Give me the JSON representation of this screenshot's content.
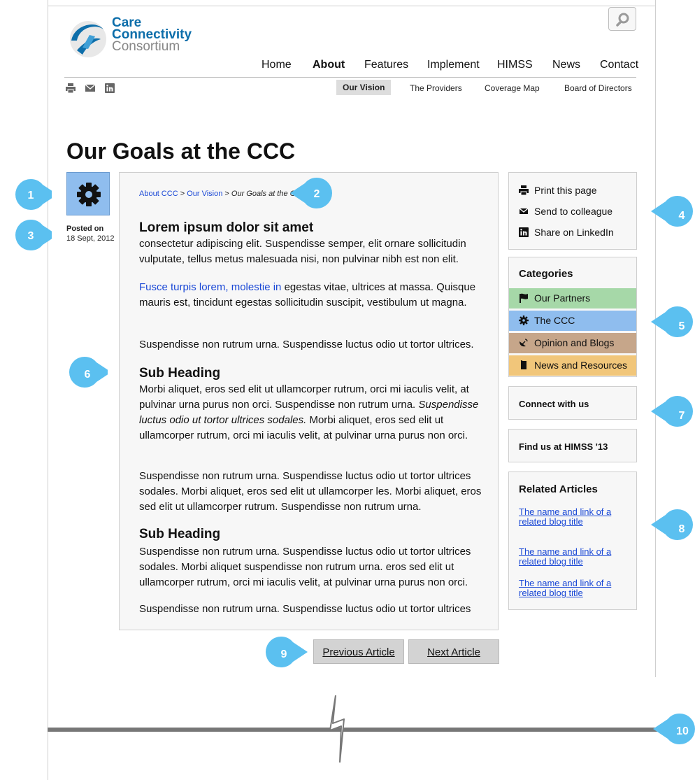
{
  "logo": {
    "line1": "Care",
    "line2": "Connectivity",
    "line3": "Consortium"
  },
  "main_nav": [
    {
      "label": "Home"
    },
    {
      "label": "About"
    },
    {
      "label": "Features"
    },
    {
      "label": "Implement"
    },
    {
      "label": "HIMSS"
    },
    {
      "label": "News"
    },
    {
      "label": "Contact"
    }
  ],
  "sub_nav": [
    {
      "label": "Our Vision"
    },
    {
      "label": "The Providers"
    },
    {
      "label": "Coverage Map"
    },
    {
      "label": "Board of Directors"
    }
  ],
  "page_title": "Our Goals at the CCC",
  "posted": {
    "label": "Posted on",
    "date": "18 Sept, 2012"
  },
  "breadcrumb": {
    "link1": "About CCC",
    "sep": " > ",
    "link2": "Our Vision",
    "current": "Our Goals at the C"
  },
  "article": {
    "heading": "Lorem ipsum dolor sit amet",
    "p1": "consectetur adipiscing elit. Suspendisse semper, elit ornare sollicitudin vulputate, tellus metus malesuada nisi, non pulvinar nibh est non elit.",
    "p2_link": "Fusce turpis lorem, molestie in",
    "p2_rest": " egestas vitae, ultrices at massa. Quisque mauris est, tincidunt egestas sollicitudin suscipit, vestibulum ut magna.",
    "p3": "Suspendisse non rutrum urna. Suspendisse luctus odio ut tortor ultrices.",
    "sub1": "Sub Heading",
    "p4_a": "Morbi aliquet, eros sed elit ut ullamcorper rutrum, orci mi iaculis velit, at pulvinar urna purus non orci. Suspendisse non rutrum urna.",
    "p4_italic": "Suspendisse luctus odio ut tortor ultrices sodales.",
    "p4_b": " Morbi aliquet, eros sed elit ut ullamcorper rutrum, orci mi iaculis velit, at pulvinar urna purus non orci.",
    "p5": "Suspendisse non rutrum urna. Suspendisse luctus odio ut tortor ultrices sodales. Morbi aliquet, eros sed elit ut ullamcorper les. Morbi aliquet, eros sed elit ut ullamcorper rutrum. Suspendisse non rutrum urna.",
    "sub2": "Sub Heading",
    "p6": "Suspendisse non rutrum urna. Suspendisse luctus odio ut tortor ultrices sodales. Morbi aliquet suspendisse non rutrum urna. eros sed elit ut ullamcorper rutrum, orci mi iaculis velit, at pulvinar urna purus non orci.",
    "p7": "Suspendisse non rutrum urna. Suspendisse luctus odio ut tortor ultrices"
  },
  "pager": {
    "prev": "Previous Article",
    "next": "Next Article"
  },
  "tools": [
    {
      "label": "Print this page",
      "icon": "print-icon"
    },
    {
      "label": "Send to colleague",
      "icon": "mail-icon"
    },
    {
      "label": "Share on LinkedIn",
      "icon": "linkedin-icon"
    }
  ],
  "categories": {
    "title": "Categories",
    "items": [
      {
        "label": "Our Partners",
        "icon": "flag-icon",
        "color": "#a6d8a8"
      },
      {
        "label": "The CCC",
        "icon": "gear-icon",
        "color": "#8fbdee"
      },
      {
        "label": "Opinion and Blogs",
        "icon": "satellite-dish-icon",
        "color": "#c6a68a"
      },
      {
        "label": "News and Resources",
        "icon": "book-icon",
        "color": "#f1c67a"
      }
    ]
  },
  "connect": "Connect with us",
  "himss": "Find us at HIMSS '13",
  "related": {
    "title": "Related Articles",
    "links": [
      {
        "line1": "The name and link of a",
        "line2": "related blog title"
      },
      {
        "line1": "The name and link of a",
        "line2": "related blog title"
      },
      {
        "line1": "The name and link of a",
        "line2": "related blog title"
      }
    ]
  },
  "callouts": [
    "1",
    "2",
    "3",
    "4",
    "5",
    "6",
    "7",
    "8",
    "9",
    "10"
  ],
  "colors": {
    "callout": "#5bc0f0",
    "brand_blue": "#0d6eaa",
    "link": "#1a48d6",
    "divider": "#777777"
  }
}
